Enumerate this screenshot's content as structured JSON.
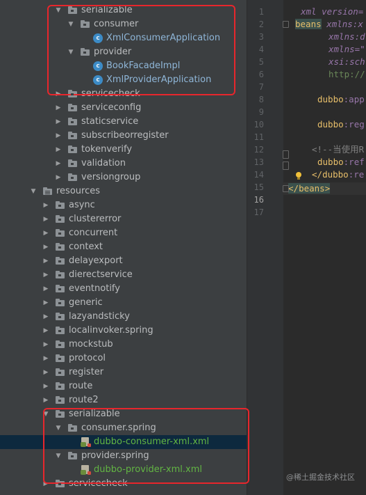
{
  "tree": {
    "items": [
      {
        "label": "serializable",
        "kind": "folder",
        "expanded": true
      },
      {
        "label": "consumer",
        "kind": "folder",
        "expanded": true
      },
      {
        "label": "XmlConsumerApplication",
        "kind": "class"
      },
      {
        "label": "provider",
        "kind": "folder",
        "expanded": true
      },
      {
        "label": "BookFacadeImpl",
        "kind": "class"
      },
      {
        "label": "XmlProviderApplication",
        "kind": "class"
      },
      {
        "label": "servicecheck",
        "kind": "folder",
        "expanded": false
      },
      {
        "label": "serviceconfig",
        "kind": "folder",
        "expanded": false
      },
      {
        "label": "staticservice",
        "kind": "folder",
        "expanded": false
      },
      {
        "label": "subscribeorregister",
        "kind": "folder",
        "expanded": false
      },
      {
        "label": "tokenverify",
        "kind": "folder",
        "expanded": false
      },
      {
        "label": "validation",
        "kind": "folder",
        "expanded": false
      },
      {
        "label": "versiongroup",
        "kind": "folder",
        "expanded": false
      },
      {
        "label": "resources",
        "kind": "resources",
        "expanded": true
      },
      {
        "label": "async",
        "kind": "folder",
        "expanded": false
      },
      {
        "label": "clustererror",
        "kind": "folder",
        "expanded": false
      },
      {
        "label": "concurrent",
        "kind": "folder",
        "expanded": false
      },
      {
        "label": "context",
        "kind": "folder",
        "expanded": false
      },
      {
        "label": "delayexport",
        "kind": "folder",
        "expanded": false
      },
      {
        "label": "dierectservice",
        "kind": "folder",
        "expanded": false
      },
      {
        "label": "eventnotify",
        "kind": "folder",
        "expanded": false
      },
      {
        "label": "generic",
        "kind": "folder",
        "expanded": false
      },
      {
        "label": "lazyandsticky",
        "kind": "folder",
        "expanded": false
      },
      {
        "label": "localinvoker.spring",
        "kind": "folder",
        "expanded": false
      },
      {
        "label": "mockstub",
        "kind": "folder",
        "expanded": false
      },
      {
        "label": "protocol",
        "kind": "folder",
        "expanded": false
      },
      {
        "label": "register",
        "kind": "folder",
        "expanded": false
      },
      {
        "label": "route",
        "kind": "folder",
        "expanded": false
      },
      {
        "label": "route2",
        "kind": "folder",
        "expanded": false
      },
      {
        "label": "serializable",
        "kind": "folder",
        "expanded": true
      },
      {
        "label": "consumer.spring",
        "kind": "folder",
        "expanded": true
      },
      {
        "label": "dubbo-consumer-xml.xml",
        "kind": "xml",
        "selected": true
      },
      {
        "label": "provider.spring",
        "kind": "folder",
        "expanded": true
      },
      {
        "label": "dubbo-provider-xml.xml",
        "kind": "xml"
      },
      {
        "label": "servicecheck",
        "kind": "folder",
        "expanded": false
      }
    ]
  },
  "editor": {
    "line_numbers": [
      "1",
      "2",
      "3",
      "4",
      "5",
      "6",
      "7",
      "8",
      "9",
      "10",
      "11",
      "12",
      "13",
      "14",
      "15",
      "16",
      "17"
    ],
    "current_line": "16",
    "lines": {
      "l1": {
        "a": "xml version=",
        "b": ""
      },
      "l2": {
        "a": "beans",
        "b": " xmlns:x"
      },
      "l3": {
        "a": "xmlns:d"
      },
      "l4": {
        "a": "xmlns=\""
      },
      "l5": {
        "a": "xsi:sch"
      },
      "l6": {
        "a": "http://"
      },
      "l8": {
        "a": "dubbo",
        "b": ":app"
      },
      "l10": {
        "a": "dubbo",
        "b": ":reg"
      },
      "l12": {
        "a": "<!--当使用R"
      },
      "l13": {
        "a": "dubbo",
        "b": ":ref"
      },
      "l14": {
        "a": "</",
        "b": "dubbo",
        "c": ":re"
      },
      "l16": {
        "a": "</",
        "b": "beans",
        "c": ">"
      }
    }
  },
  "watermark": "@稀土掘金技术社区",
  "colors": {
    "panel": "#3c3f41",
    "editor": "#2b2b2b",
    "highlight_box": "#e8262c",
    "selection": "#0d293e",
    "resource_file_text": "#62b543"
  }
}
